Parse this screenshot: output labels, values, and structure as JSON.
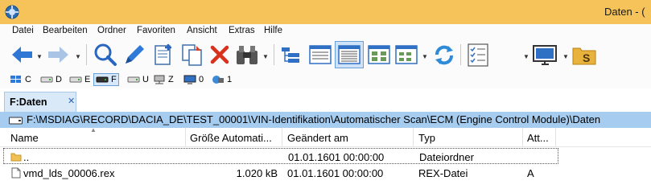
{
  "window": {
    "title": "Daten - ("
  },
  "menu": [
    "Datei",
    "Bearbeiten",
    "Ordner",
    "Favoriten",
    "Ansicht",
    "Extras",
    "Hilfe"
  ],
  "toolbar": {
    "buttons": [
      "back",
      "forward",
      "search",
      "edit",
      "new-file",
      "copy",
      "delete",
      "binoculars",
      "tree-view",
      "details-view",
      "list-view",
      "thumbnails-view",
      "small-icons-view",
      "refresh",
      "checklist",
      "dropdown",
      "monitor",
      "s-drive"
    ]
  },
  "drives": [
    {
      "letter": "C",
      "icon": "windows-drive-icon"
    },
    {
      "letter": "D",
      "icon": "drive-icon"
    },
    {
      "letter": "E",
      "icon": "drive-icon"
    },
    {
      "letter": "F",
      "icon": "drive-icon",
      "active": true
    },
    {
      "letter": "U",
      "icon": "drive-icon"
    },
    {
      "letter": "Z",
      "icon": "network-drive-icon"
    },
    {
      "letter": "0",
      "icon": "monitor-icon"
    },
    {
      "letter": "1",
      "icon": "network-icon"
    }
  ],
  "tab": {
    "label": "F:Daten",
    "close": "✕"
  },
  "path": "F:\\MSDIAG\\RECORD\\DACIA_DE\\TEST_00001\\VIN-Identifikation\\Automatischer Scan\\ECM (Engine Control Module)\\Daten",
  "table": {
    "columns": [
      "Name",
      "Größe Automati...",
      "Geändert am",
      "Typ",
      "Att..."
    ],
    "rows": [
      {
        "name": "..",
        "size": "",
        "modified": "01.01.1601 00:00:00",
        "type": "Dateiordner",
        "attr": "",
        "icon": "folder-icon"
      },
      {
        "name": "vmd_lds_00006.rex",
        "size": "1.020 kB",
        "modified": "01.01.1601 00:00:00",
        "type": "REX-Datei",
        "attr": "A",
        "icon": "file-icon"
      }
    ]
  },
  "colors": {
    "titlebar": "#f6c35a",
    "pathbar": "#a6cdf0",
    "tab": "#d9e9f8"
  }
}
